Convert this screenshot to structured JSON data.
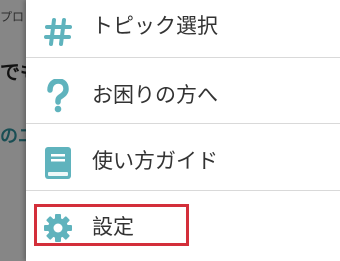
{
  "background": {
    "small_text": "プロ",
    "bold_text": "でも",
    "link_text": "のユ"
  },
  "menu": {
    "items": [
      {
        "label": "トピック選択",
        "icon": "hash-icon"
      },
      {
        "label": "お困りの方へ",
        "icon": "question-icon"
      },
      {
        "label": "使い方ガイド",
        "icon": "book-icon"
      },
      {
        "label": "設定",
        "icon": "gear-icon"
      }
    ]
  },
  "colors": {
    "icon": "#5fb3bd",
    "highlight": "#d32f3a"
  }
}
